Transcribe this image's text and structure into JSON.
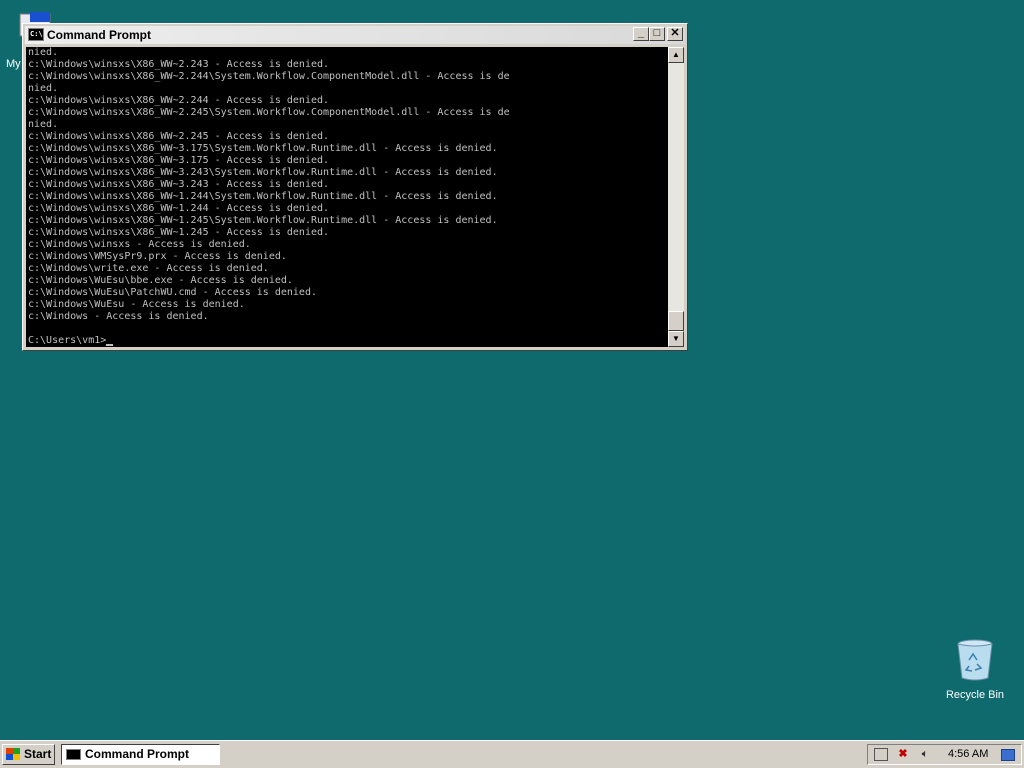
{
  "desktop": {
    "icons": {
      "my_computer": "My",
      "recycle_bin": "Recycle Bin"
    }
  },
  "window": {
    "title": "Command Prompt",
    "icon_text": "C:\\",
    "buttons": {
      "minimize": "_",
      "maximize": "□",
      "close": "✕"
    }
  },
  "console": {
    "lines": [
      "nied.",
      "c:\\Windows\\winsxs\\X86_WW~2.243 - Access is denied.",
      "c:\\Windows\\winsxs\\X86_WW~2.244\\System.Workflow.ComponentModel.dll - Access is de",
      "nied.",
      "c:\\Windows\\winsxs\\X86_WW~2.244 - Access is denied.",
      "c:\\Windows\\winsxs\\X86_WW~2.245\\System.Workflow.ComponentModel.dll - Access is de",
      "nied.",
      "c:\\Windows\\winsxs\\X86_WW~2.245 - Access is denied.",
      "c:\\Windows\\winsxs\\X86_WW~3.175\\System.Workflow.Runtime.dll - Access is denied.",
      "c:\\Windows\\winsxs\\X86_WW~3.175 - Access is denied.",
      "c:\\Windows\\winsxs\\X86_WW~3.243\\System.Workflow.Runtime.dll - Access is denied.",
      "c:\\Windows\\winsxs\\X86_WW~3.243 - Access is denied.",
      "c:\\Windows\\winsxs\\X86_WW~1.244\\System.Workflow.Runtime.dll - Access is denied.",
      "c:\\Windows\\winsxs\\X86_WW~1.244 - Access is denied.",
      "c:\\Windows\\winsxs\\X86_WW~1.245\\System.Workflow.Runtime.dll - Access is denied.",
      "c:\\Windows\\winsxs\\X86_WW~1.245 - Access is denied.",
      "c:\\Windows\\winsxs - Access is denied.",
      "c:\\Windows\\WMSysPr9.prx - Access is denied.",
      "c:\\Windows\\write.exe - Access is denied.",
      "c:\\Windows\\WuEsu\\bbe.exe - Access is denied.",
      "c:\\Windows\\WuEsu\\PatchWU.cmd - Access is denied.",
      "c:\\Windows\\WuEsu - Access is denied.",
      "c:\\Windows - Access is denied.",
      ""
    ],
    "prompt": "C:\\Users\\vm1>"
  },
  "taskbar": {
    "start_label": "Start",
    "task_item": "Command Prompt",
    "clock": "4:56 AM"
  },
  "colors": {
    "desktop_bg": "#0f6a6e",
    "console_bg": "#000000",
    "console_fg": "#c0c0c0"
  }
}
